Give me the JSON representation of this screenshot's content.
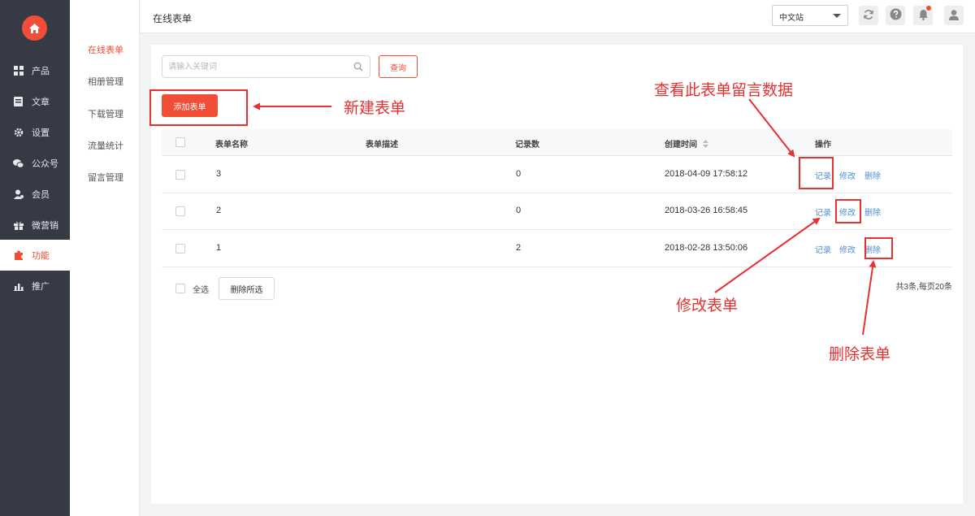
{
  "sidebar": {
    "items": [
      {
        "label": "产品",
        "icon": "grid-icon"
      },
      {
        "label": "文章",
        "icon": "article-icon"
      },
      {
        "label": "设置",
        "icon": "gear-icon"
      },
      {
        "label": "公众号",
        "icon": "wechat-icon"
      },
      {
        "label": "会员",
        "icon": "member-icon"
      },
      {
        "label": "微营销",
        "icon": "gift-icon"
      },
      {
        "label": "功能",
        "icon": "puzzle-icon",
        "active": true
      },
      {
        "label": "推广",
        "icon": "chart-icon"
      }
    ]
  },
  "submenu": {
    "items": [
      {
        "label": "在线表单",
        "active": true
      },
      {
        "label": "相册管理"
      },
      {
        "label": "下载管理"
      },
      {
        "label": "流量统计"
      },
      {
        "label": "留言管理"
      }
    ]
  },
  "header": {
    "title": "在线表单",
    "language": "中文站"
  },
  "search": {
    "placeholder": "请输入关键词",
    "button": "查询"
  },
  "add_button": "添加表单",
  "table": {
    "columns": [
      "表单名称",
      "表单描述",
      "记录数",
      "创建时间",
      "操作"
    ],
    "rows": [
      {
        "name": "3",
        "description": "",
        "records": "0",
        "created": "2018-04-09 17:58:12"
      },
      {
        "name": "2",
        "description": "",
        "records": "0",
        "created": "2018-03-26 16:58:45"
      },
      {
        "name": "1",
        "description": "",
        "records": "2",
        "created": "2018-02-28 13:50:06"
      }
    ],
    "actions": {
      "records": "记录",
      "edit": "修改",
      "delete": "删除"
    }
  },
  "footer": {
    "select_all": "全选",
    "delete_selected": "删除所选",
    "pager": "共3条,每页20条"
  },
  "annotations": {
    "new_form": "新建表单",
    "view_records": "查看此表单留言数据",
    "edit_form": "修改表单",
    "delete_form": "删除表单"
  },
  "colors": {
    "accent": "#f04e37",
    "sidebar_bg": "#353a45",
    "link": "#4f8fd4",
    "annotation": "#e8302f"
  }
}
